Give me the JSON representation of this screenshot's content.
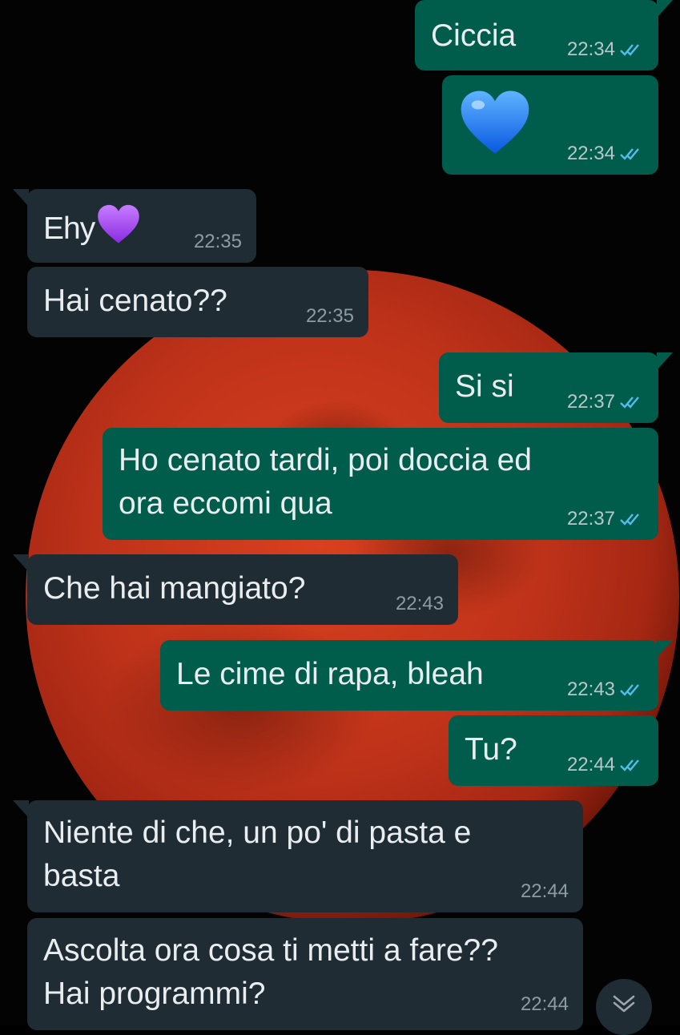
{
  "colors": {
    "outgoing_bubble": "#005c4b",
    "incoming_bubble": "#1f2c34",
    "read_ticks": "#53bdeb",
    "wallpaper_moon": "#c0331a"
  },
  "messages": [
    {
      "direction": "out",
      "text": "Ciccia",
      "time": "22:34",
      "status": "read"
    },
    {
      "direction": "out",
      "emoji": "blue-heart",
      "text": "",
      "time": "22:34",
      "status": "read"
    },
    {
      "direction": "in",
      "text": "Ehy",
      "emoji": "purple-heart",
      "time": "22:35"
    },
    {
      "direction": "in",
      "text": "Hai cenato??",
      "time": "22:35"
    },
    {
      "direction": "out",
      "text": "Si si",
      "time": "22:37",
      "status": "read"
    },
    {
      "direction": "out",
      "text": "Ho cenato tardi, poi doccia ed\nora eccomi qua",
      "time": "22:37",
      "status": "read"
    },
    {
      "direction": "in",
      "text": "Che hai mangiato?",
      "time": "22:43"
    },
    {
      "direction": "out",
      "text": "Le cime di rapa, bleah",
      "time": "22:43",
      "status": "read"
    },
    {
      "direction": "out",
      "text": "Tu?",
      "time": "22:44",
      "status": "read"
    },
    {
      "direction": "in",
      "text": "Niente di che, un po' di pasta e\nbasta",
      "time": "22:44"
    },
    {
      "direction": "in",
      "text": "Ascolta ora cosa ti metti a fare??\nHai programmi?",
      "time": "22:44"
    }
  ],
  "scroll_button": {
    "icon": "double-chevron-down-icon"
  }
}
